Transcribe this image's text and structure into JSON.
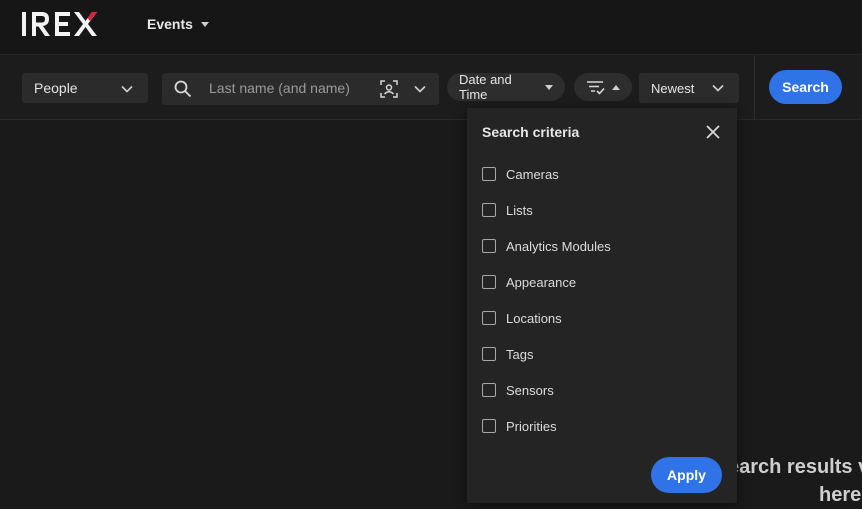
{
  "brand": {
    "logo_text": "IREX",
    "accent": "#e01f3d"
  },
  "topnav": {
    "events_label": "Events"
  },
  "filters": {
    "category_select": "People",
    "search_placeholder": "Last name (and name)",
    "date_time_label": "Date and Time",
    "sort_label": "Newest",
    "search_button": "Search"
  },
  "criteria_panel": {
    "title": "Search criteria",
    "items": [
      "Cameras",
      "Lists",
      "Analytics Modules",
      "Appearance",
      "Locations",
      "Tags",
      "Sensors",
      "Priorities"
    ],
    "apply_button": "Apply"
  },
  "results": {
    "line1": "earch results v",
    "line2": "here"
  },
  "colors": {
    "primary": "#2f73e6",
    "background": "#1a1a1a",
    "panel": "#242424"
  }
}
